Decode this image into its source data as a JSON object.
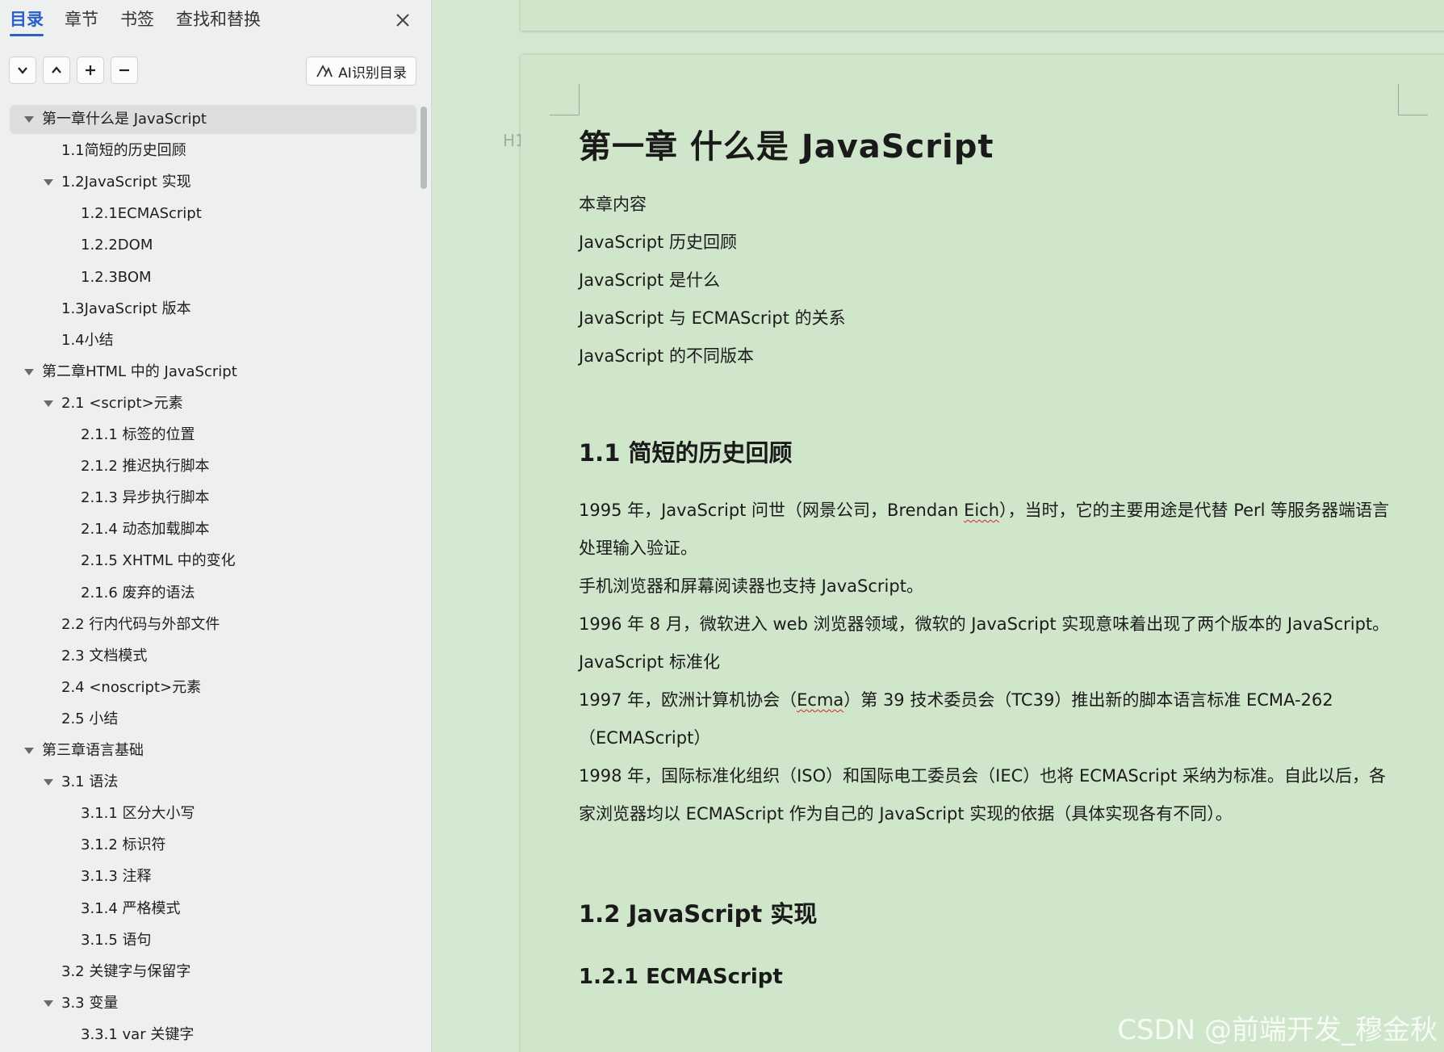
{
  "sidebar": {
    "tabs": [
      "目录",
      "章节",
      "书签",
      "查找和替换"
    ],
    "active_tab": 0,
    "toolbar": {
      "ai_button_label": "AI识别目录"
    },
    "toc": [
      {
        "text": "第一章什么是 JavaScript",
        "level": 0,
        "expanded": true,
        "selected": true
      },
      {
        "text": "1.1简短的历史回顾",
        "level": 1
      },
      {
        "text": "1.2JavaScript 实现",
        "level": 1,
        "expanded": true
      },
      {
        "text": "1.2.1ECMAScript",
        "level": 2
      },
      {
        "text": "1.2.2DOM",
        "level": 2
      },
      {
        "text": "1.2.3BOM",
        "level": 2
      },
      {
        "text": "1.3JavaScript 版本",
        "level": 1
      },
      {
        "text": "1.4小结",
        "level": 1
      },
      {
        "text": "第二章HTML 中的 JavaScript",
        "level": 0,
        "expanded": true
      },
      {
        "text": "2.1 <script>元素",
        "level": 1,
        "expanded": true
      },
      {
        "text": "2.1.1  标签的位置",
        "level": 2
      },
      {
        "text": "2.1.2  推迟执行脚本",
        "level": 2
      },
      {
        "text": "2.1.3  异步执行脚本",
        "level": 2
      },
      {
        "text": "2.1.4  动态加载脚本",
        "level": 2
      },
      {
        "text": "2.1.5 XHTML 中的变化",
        "level": 2
      },
      {
        "text": "2.1.6  废弃的语法",
        "level": 2
      },
      {
        "text": "2.2  行内代码与外部文件",
        "level": 1
      },
      {
        "text": "2.3  文档模式",
        "level": 1
      },
      {
        "text": "2.4 <noscript>元素",
        "level": 1
      },
      {
        "text": "2.5  小结",
        "level": 1
      },
      {
        "text": "第三章语言基础",
        "level": 0,
        "expanded": true
      },
      {
        "text": "3.1 语法",
        "level": 1,
        "expanded": true
      },
      {
        "text": "3.1.1  区分大小写",
        "level": 2
      },
      {
        "text": "3.1.2  标识符",
        "level": 2
      },
      {
        "text": "3.1.3  注释",
        "level": 2
      },
      {
        "text": "3.1.4  严格模式",
        "level": 2
      },
      {
        "text": "3.1.5  语句",
        "level": 2
      },
      {
        "text": "3.2  关键字与保留字",
        "level": 1
      },
      {
        "text": "3.3  变量",
        "level": 1,
        "expanded": true
      },
      {
        "text": "3.3.1 var 关键字",
        "level": 2
      }
    ]
  },
  "document": {
    "heading_marker": "H1",
    "title": "第一章  什么是 JavaScript",
    "intro": [
      "本章内容",
      "JavaScript 历史回顾",
      "JavaScript 是什么",
      "JavaScript 与 ECMAScript 的关系",
      "JavaScript 的不同版本"
    ],
    "section_1_1": {
      "heading": "1.1  简短的历史回顾",
      "p1_before": "1995 年，JavaScript 问世（网景公司，Brendan ",
      "p1_squiggle": "Eich",
      "p1_after": "），当时，它的主要用途是代替 Perl 等服务器端语言处理输入验证。",
      "p2": "手机浏览器和屏幕阅读器也支持 JavaScript。",
      "p3": "1996 年 8 月，微软进入 web 浏览器领域，微软的 JavaScript 实现意味着出现了两个版本的 JavaScript。",
      "p4": "JavaScript 标准化",
      "p5_before": "1997 年，欧洲计算机协会（",
      "p5_squiggle": "Ecma",
      "p5_after": "）第 39 技术委员会（TC39）推出新的脚本语言标准 ECMA-262（ECMAScript）",
      "p6": "1998 年，国际标准化组织（ISO）和国际电工委员会（IEC）也将 ECMAScript 采纳为标准。自此以后，各家浏览器均以 ECMAScript 作为自己的 JavaScript 实现的依据（具体实现各有不同）。"
    },
    "section_1_2": {
      "heading": "1.2  JavaScript 实现"
    },
    "section_1_2_1": {
      "heading": "1.2.1  ECMAScript"
    }
  },
  "watermark": "CSDN @前端开发_穆金秋",
  "colors": {
    "accent": "#2a61c8",
    "page_bg": "#cfe6cb",
    "sidebar_bg": "#edf0ee"
  }
}
